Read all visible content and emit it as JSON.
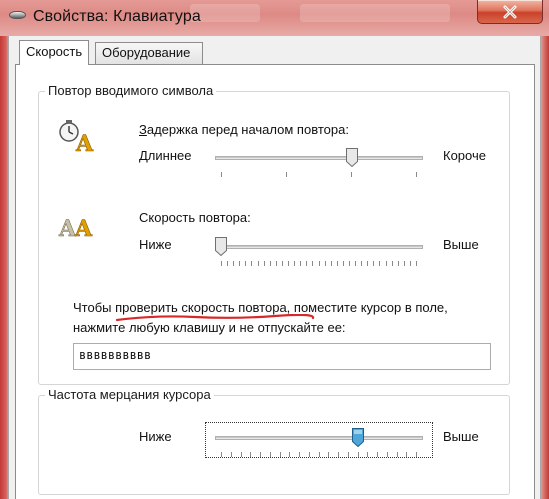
{
  "window": {
    "title": "Свойства: Клавиатура",
    "close_icon": "close-icon"
  },
  "tabs": [
    {
      "label": "Скорость",
      "active": true
    },
    {
      "label": "Оборудование",
      "active": false
    }
  ],
  "repeat_group": {
    "title": "Повтор вводимого символа",
    "delay": {
      "icon": "clock-letter-icon",
      "label": "Задержка перед началом повтора:",
      "min_label": "Длиннее",
      "max_label": "Короче",
      "value": 0.67,
      "ticks": 4
    },
    "rate": {
      "icon": "double-letter-icon",
      "label": "Скорость повтора:",
      "min_label": "Ниже",
      "max_label": "Выше",
      "value": 0.0,
      "ticks": 33
    },
    "test_hint_line1": "Чтобы проверить скорость повтора, поместите курсор в поле,",
    "test_hint_line2": "нажмите любую клавишу и не отпускайте ее:",
    "test_value": "вввввввввв"
  },
  "blink_group": {
    "title": "Частота мерцания курсора",
    "min_label": "Ниже",
    "max_label": "Выше",
    "value": 0.7,
    "ticks": 21
  },
  "colors": {
    "accent_thumb": "#4ea7d8",
    "annotation_red": "#d62a2a"
  }
}
